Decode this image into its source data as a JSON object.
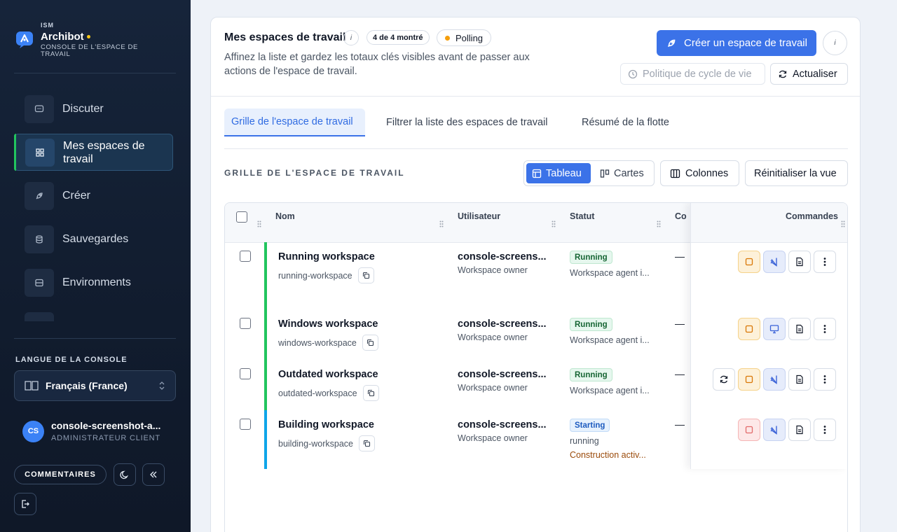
{
  "brand": {
    "small": "ISM",
    "name": "Archibot",
    "subtitle": "CONSOLE DE L'ESPACE DE TRAVAIL"
  },
  "nav": [
    {
      "label": "Discuter",
      "icon": "chat-icon"
    },
    {
      "label": "Mes espaces de travail",
      "icon": "grid-icon",
      "active": true
    },
    {
      "label": "Créer",
      "icon": "rocket-icon"
    },
    {
      "label": "Sauvegardes",
      "icon": "database-icon"
    },
    {
      "label": "Environments",
      "icon": "server-icon"
    }
  ],
  "language": {
    "title": "LANGUE DE LA CONSOLE",
    "value": "Français (France)"
  },
  "user": {
    "initials": "CS",
    "name": "console-screenshot-a...",
    "role": "ADMINISTRATEUR CLIENT"
  },
  "footer": {
    "feedback": "COMMENTAIRES"
  },
  "header": {
    "title": "Mes espaces de travail",
    "info": "i",
    "count": "4 de 4 montré",
    "polling": "Polling",
    "description": "Affinez la liste et gardez les totaux clés visibles avant de passer aux actions de l'espace de travail.",
    "create": "Créer un espace de travail",
    "lifecycle": "Politique de cycle de vie",
    "refresh": "Actualiser"
  },
  "tabs": [
    "Grille de l'espace de travail",
    "Filtrer la liste des espaces de travail",
    "Résumé de la flotte"
  ],
  "grid": {
    "title": "GRILLE DE L'ESPACE DE TRAVAIL",
    "view_table": "Tableau",
    "view_cards": "Cartes",
    "columns": "Colonnes",
    "reset": "Réinitialiser la vue"
  },
  "table": {
    "headers": {
      "name": "Nom",
      "user": "Utilisateur",
      "status": "Statut",
      "cmd_partial": "Co",
      "commands": "Commandes"
    },
    "rows": [
      {
        "name": "Running workspace",
        "slug": "running-workspace",
        "user": "console-screens...",
        "owner": "Workspace owner",
        "badge": "Running",
        "status_text": "Workspace agent i...",
        "extra": "",
        "dash": "—"
      },
      {
        "name": "Windows workspace",
        "slug": "windows-workspace",
        "user": "console-screens...",
        "owner": "Workspace owner",
        "badge": "Running",
        "status_text": "Workspace agent i...",
        "extra": "",
        "dash": "—"
      },
      {
        "name": "Outdated workspace",
        "slug": "outdated-workspace",
        "user": "console-screens...",
        "owner": "Workspace owner",
        "badge": "Running",
        "status_text": "Workspace agent i...",
        "extra": "",
        "dash": "—"
      },
      {
        "name": "Building workspace",
        "slug": "building-workspace",
        "user": "console-screens...",
        "owner": "Workspace owner",
        "badge": "Starting",
        "status_text": "running",
        "extra": "Construction activ...",
        "dash": "—"
      }
    ]
  },
  "colors": {
    "accent": "#3b72e8",
    "running": "#22c55e",
    "starting": "#0ea5e9",
    "sidebar": "#16243a"
  }
}
